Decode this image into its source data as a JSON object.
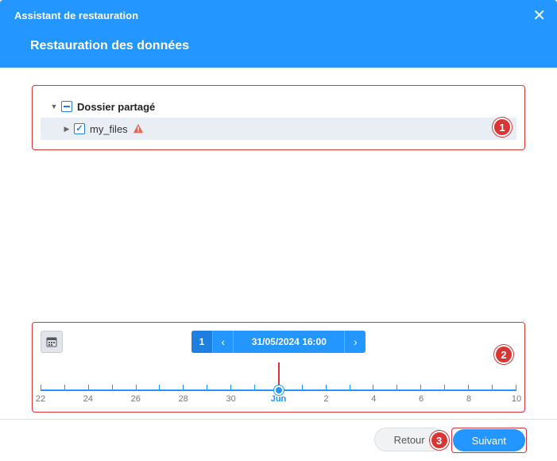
{
  "header": {
    "title": "Assistant de restauration",
    "subtitle": "Restauration des données"
  },
  "tree": {
    "root": {
      "label": "Dossier partagé",
      "state": "partial",
      "expanded": true
    },
    "child": {
      "label": "my_files",
      "state": "checked",
      "expanded": false,
      "warning": true
    }
  },
  "timeline": {
    "version_count": "1",
    "selected_datetime": "31/05/2024 16:00",
    "month_label": "Jun",
    "ticks": [
      "22",
      "24",
      "26",
      "28",
      "30",
      "Jun",
      "2",
      "4",
      "6",
      "8",
      "10"
    ]
  },
  "footer": {
    "back_label": "Retour",
    "next_label": "Suivant"
  },
  "callouts": {
    "one": "1",
    "two": "2",
    "three": "3"
  }
}
